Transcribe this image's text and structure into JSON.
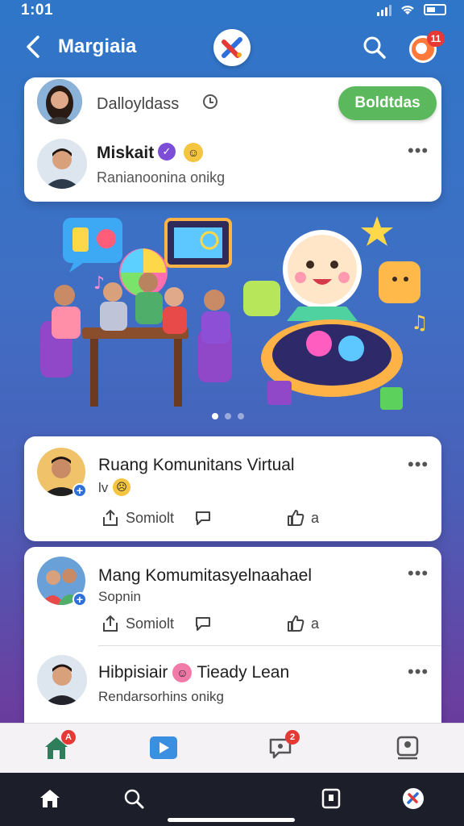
{
  "status_bar": {
    "time": "1:01"
  },
  "header": {
    "title": "Margiaia",
    "notif_count": "11"
  },
  "top_card": {
    "row1_title": "Dalloyldass",
    "action_button": "Boldtdas",
    "user_name": "Miskait",
    "user_sub": "Ranianoonina onikg"
  },
  "carousel": {
    "pages": 3,
    "active": 0
  },
  "posts": [
    {
      "title": "Ruang Komunitans Virtual",
      "sub": "lv",
      "share_label": "Somiolt",
      "like_count": "a"
    },
    {
      "title": "Mang Komumitasyelnaahael",
      "sub": "Sopnin",
      "share_label": "Somiolt",
      "like_count": "a"
    },
    {
      "title": "Hibpisiair",
      "title_suffix": "Tieady Lean",
      "sub": "Rendarsorhins onikg"
    }
  ],
  "bottom_nav": {
    "home_badge": "A",
    "chat_badge": "2"
  },
  "colors": {
    "accent_green": "#5cb85c",
    "badge_red": "#e53935",
    "brand_blue": "#2f6fdc"
  },
  "icons": [
    "back-arrow-icon",
    "app-logo-icon",
    "search-icon",
    "notification-icon",
    "clock-icon",
    "verified-icon",
    "more-icon",
    "share-icon",
    "comment-icon",
    "like-icon",
    "home-icon",
    "play-icon",
    "chat-icon",
    "profile-icon"
  ]
}
